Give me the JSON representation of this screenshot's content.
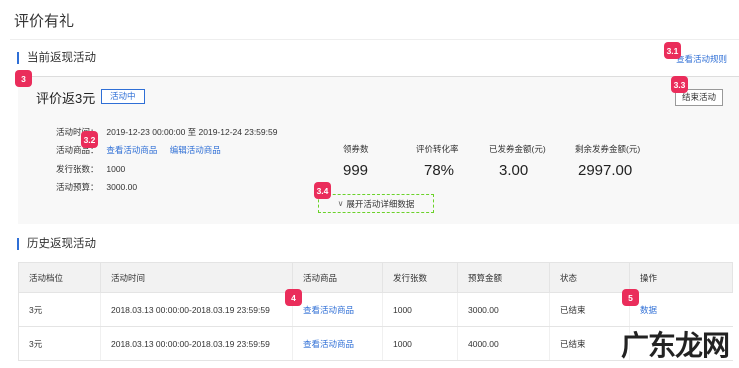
{
  "page_title": "评价有礼",
  "current_section": {
    "title": "当前返现活动",
    "rules_link": "查看活动规则",
    "activity": {
      "name": "评价返3元",
      "status": "活动中",
      "end_button": "结束活动",
      "time_label": "活动时间：",
      "time_value": "2019-12-23 00:00:00 至 2019-12-24 23:59:59",
      "goods_label": "活动商品：",
      "view_goods": "查看活动商品",
      "edit_goods": "编辑活动商品",
      "issued_label": "发行张数：",
      "issued_value": "1000",
      "budget_label": "活动预算：",
      "budget_value": "3000.00",
      "expand_label": "展开活动详细数据"
    },
    "stats": [
      {
        "label": "领券数",
        "value": "999"
      },
      {
        "label": "评价转化率",
        "value": "78%"
      },
      {
        "label": "已发券金额(元)",
        "value": "3.00"
      },
      {
        "label": "剩余发券金额(元)",
        "value": "2997.00"
      }
    ]
  },
  "history_section": {
    "title": "历史返现活动",
    "columns": [
      "活动档位",
      "活动时间",
      "活动商品",
      "发行张数",
      "预算金额",
      "状态",
      "操作"
    ],
    "rows": [
      {
        "tier": "3元",
        "time": "2018.03.13 00:00:00-2018.03.19 23:59:59",
        "goods": "查看活动商品",
        "issued": "1000",
        "budget": "3000.00",
        "status": "已结束",
        "action": "数据"
      },
      {
        "tier": "3元",
        "time": "2018.03.13 00:00:00-2018.03.19 23:59:59",
        "goods": "查看活动商品",
        "issued": "1000",
        "budget": "4000.00",
        "status": "已结束",
        "action": ""
      }
    ]
  },
  "badges": {
    "b3": "3",
    "b31": "3.1",
    "b32": "3.2",
    "b33": "3.3",
    "b34": "3.4",
    "b4": "4",
    "b5": "5"
  },
  "watermark": "广东龙网",
  "colors": {
    "accent": "#2f6fd6",
    "badge": "#ea2d5b",
    "dashed_box": "#6bd22a"
  }
}
